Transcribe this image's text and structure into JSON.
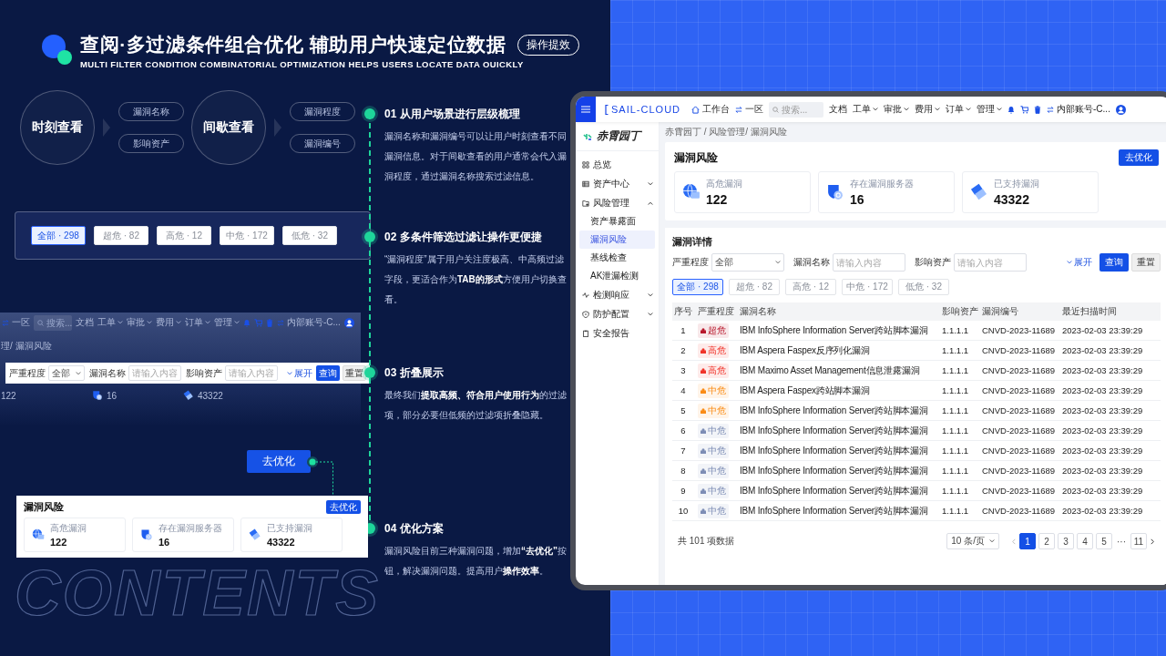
{
  "header": {
    "title": "查阅·多过滤条件组合优化 辅助用户快速定位数据",
    "subtitle": "MULTI FILTER CONDITION COMBINATORIAL OPTIMIZATION HELPS USERS LOCATE DATA OUICKLY",
    "badge": "操作提效"
  },
  "scenarios": [
    {
      "mode": "时刻查看",
      "fields": [
        "漏洞名称",
        "影响资产"
      ]
    },
    {
      "mode": "间歇查看",
      "fields": [
        "漏洞程度",
        "漏洞编号"
      ]
    }
  ],
  "tab_demo": [
    {
      "label": "全部 · 298",
      "selected": true
    },
    {
      "label": "超危 · 82",
      "selected": false
    },
    {
      "label": "高危 · 12",
      "selected": false
    },
    {
      "label": "中危 · 172",
      "selected": false
    },
    {
      "label": "低危 · 32",
      "selected": false
    }
  ],
  "steps": [
    {
      "title": "01 从用户场景进行层级梳理",
      "text": "漏洞名称和漏洞编号可以让用户时刻查看不同漏洞信息。对于间歇查看的用户通常会代入漏洞程度，通过漏洞名称搜索过滤信息。"
    },
    {
      "title": "02 多条件筛选过滤让操作更便捷",
      "text": "“漏洞程度”属于用户关注度极高、中高频过滤字段，更适合作为**TAB的形式**方便用户切换查看。"
    },
    {
      "title": "03 折叠展示",
      "text": "最终我们**提取高频、符合用户使用行为**的过滤项，部分必要但低频的过滤项折叠隐藏。"
    },
    {
      "title": "04 优化方案",
      "text": "漏洞风险目前三种漏洞问题，增加**“去优化”**按钮，解决漏洞问题。提高用户**操作效率**。"
    }
  ],
  "faded_screen": {
    "topbar": {
      "region": "一区",
      "search": {
        "placeholder": "搜索..."
      },
      "menus": [
        {
          "label": "文档",
          "dropdown": false
        },
        {
          "label": "工单",
          "dropdown": true
        },
        {
          "label": "审批",
          "dropdown": true
        },
        {
          "label": "费用",
          "dropdown": true
        },
        {
          "label": "订单",
          "dropdown": true
        },
        {
          "label": "管理",
          "dropdown": true
        }
      ],
      "account": "内部账号-C..."
    },
    "breadcrumb": "理/ 漏洞风险",
    "values": [
      "122",
      "16",
      "43322"
    ]
  },
  "filter_demo": {
    "fields": [
      {
        "label": "严重程度",
        "kind": "select",
        "value": "全部"
      },
      {
        "label": "漏洞名称",
        "kind": "input",
        "placeholder": "请输入内容"
      },
      {
        "label": "影响资产",
        "kind": "input",
        "placeholder": "请输入内容"
      }
    ],
    "expand": "展开",
    "buttons": [
      {
        "label": "查询",
        "kind": "primary"
      },
      {
        "label": "重置",
        "kind": "default"
      }
    ]
  },
  "callout_button": "去优化",
  "risk_demo": {
    "title": "漏洞风险",
    "button": "去优化",
    "stats": [
      {
        "label": "高危漏洞",
        "value": "122"
      },
      {
        "label": "存在漏洞服务器",
        "value": "16"
      },
      {
        "label": "已支持漏洞",
        "value": "43322"
      }
    ]
  },
  "background_word": "CONTENTS",
  "app": {
    "logo": "SAIL-CLOUD",
    "topbar": {
      "workbench": "工作台",
      "region": "一区",
      "search": {
        "placeholder": "搜索..."
      },
      "menus": [
        {
          "label": "文档",
          "dropdown": false
        },
        {
          "label": "工单",
          "dropdown": true
        },
        {
          "label": "审批",
          "dropdown": true
        },
        {
          "label": "费用",
          "dropdown": true
        },
        {
          "label": "订单",
          "dropdown": true
        },
        {
          "label": "管理",
          "dropdown": true
        }
      ],
      "account": "内部账号-C..."
    },
    "sidebar": {
      "brand": "赤霄园丁",
      "items": [
        {
          "label": "总览",
          "kind": "link",
          "selected": false
        },
        {
          "label": "资产中心",
          "kind": "group",
          "expanded": false,
          "selected": false
        },
        {
          "label": "风险管理",
          "kind": "group",
          "expanded": true,
          "selected": false,
          "children": [
            {
              "label": "资产暴露面",
              "selected": false
            },
            {
              "label": "漏洞风险",
              "selected": true
            },
            {
              "label": "基线检查",
              "selected": false
            },
            {
              "label": "AK泄漏检测",
              "selected": false
            }
          ]
        },
        {
          "label": "检测响应",
          "kind": "group",
          "expanded": false,
          "selected": false
        },
        {
          "label": "防护配置",
          "kind": "group",
          "expanded": false,
          "selected": false
        },
        {
          "label": "安全报告",
          "kind": "link",
          "selected": false
        }
      ]
    },
    "breadcrumb": "赤霄园丁 / 风险管理/ 漏洞风险",
    "risk": {
      "title": "漏洞风险",
      "button": "去优化",
      "stats": [
        {
          "label": "高危漏洞",
          "value": "122"
        },
        {
          "label": "存在漏洞服务器",
          "value": "16"
        },
        {
          "label": "已支持漏洞",
          "value": "43322"
        }
      ]
    },
    "detail": {
      "title": "漏洞详情",
      "filters": {
        "fields": [
          {
            "label": "严重程度",
            "kind": "select",
            "value": "全部"
          },
          {
            "label": "漏洞名称",
            "kind": "input",
            "placeholder": "请输入内容"
          },
          {
            "label": "影响资产",
            "kind": "input",
            "placeholder": "请输入内容"
          }
        ],
        "expand": "展开",
        "buttons": [
          {
            "label": "查询",
            "kind": "primary"
          },
          {
            "label": "重置",
            "kind": "default"
          }
        ]
      },
      "tabs": [
        {
          "label": "全部 · 298",
          "selected": true
        },
        {
          "label": "超危 · 82",
          "selected": false
        },
        {
          "label": "高危 · 12",
          "selected": false
        },
        {
          "label": "中危 · 172",
          "selected": false
        },
        {
          "label": "低危 · 32",
          "selected": false
        }
      ],
      "table": {
        "columns": [
          "序号",
          "严重程度",
          "漏洞名称",
          "影响资产",
          "漏洞编号",
          "最近扫描时间"
        ],
        "rows": [
          {
            "no": "1",
            "severity": "超危",
            "color": "#b8182c",
            "name": "IBM InfoSphere Information Server跨站脚本漏洞",
            "asset": "1.1.1.1",
            "id": "CNVD-2023-11689",
            "time": "2023-02-03 23:39:29"
          },
          {
            "no": "2",
            "severity": "高危",
            "color": "#f0342a",
            "name": "IBM Aspera Faspex反序列化漏洞",
            "asset": "1.1.1.1",
            "id": "CNVD-2023-11689",
            "time": "2023-02-03 23:39:29"
          },
          {
            "no": "3",
            "severity": "高危",
            "color": "#f0342a",
            "name": "IBM Maximo Asset Management信息泄露漏洞",
            "asset": "1.1.1.1",
            "id": "CNVD-2023-11689",
            "time": "2023-02-03 23:39:29"
          },
          {
            "no": "4",
            "severity": "中危",
            "color": "#fa8c16",
            "name": "IBM Aspera Faspex跨站脚本漏洞",
            "asset": "1.1.1.1",
            "id": "CNVD-2023-11689",
            "time": "2023-02-03 23:39:29"
          },
          {
            "no": "5",
            "severity": "中危",
            "color": "#fa8c16",
            "name": "IBM InfoSphere Information Server跨站脚本漏洞",
            "asset": "1.1.1.1",
            "id": "CNVD-2023-11689",
            "time": "2023-02-03 23:39:29"
          },
          {
            "no": "6",
            "severity": "中危",
            "color": "#7d8db5",
            "name": "IBM InfoSphere Information Server跨站脚本漏洞",
            "asset": "1.1.1.1",
            "id": "CNVD-2023-11689",
            "time": "2023-02-03 23:39:29"
          },
          {
            "no": "7",
            "severity": "中危",
            "color": "#7d8db5",
            "name": "IBM InfoSphere Information Server跨站脚本漏洞",
            "asset": "1.1.1.1",
            "id": "CNVD-2023-11689",
            "time": "2023-02-03 23:39:29"
          },
          {
            "no": "8",
            "severity": "中危",
            "color": "#7d8db5",
            "name": "IBM InfoSphere Information Server跨站脚本漏洞",
            "asset": "1.1.1.1",
            "id": "CNVD-2023-11689",
            "time": "2023-02-03 23:39:29"
          },
          {
            "no": "9",
            "severity": "中危",
            "color": "#7d8db5",
            "name": "IBM InfoSphere Information Server跨站脚本漏洞",
            "asset": "1.1.1.1",
            "id": "CNVD-2023-11689",
            "time": "2023-02-03 23:39:29"
          },
          {
            "no": "10",
            "severity": "中危",
            "color": "#7d8db5",
            "name": "IBM InfoSphere Information Server跨站脚本漏洞",
            "asset": "1.1.1.1",
            "id": "CNVD-2023-11689",
            "time": "2023-02-03 23:39:29"
          }
        ]
      },
      "total": "共 101 项数据",
      "page_size": "10 条/页",
      "pages": [
        {
          "label": "1",
          "kind": "page",
          "selected": true
        },
        {
          "label": "2",
          "kind": "page",
          "selected": false
        },
        {
          "label": "3",
          "kind": "page",
          "selected": false
        },
        {
          "label": "4",
          "kind": "page",
          "selected": false
        },
        {
          "label": "5",
          "kind": "page",
          "selected": false
        },
        {
          "label": "···",
          "kind": "ellipsis",
          "selected": false
        },
        {
          "label": "11",
          "kind": "page",
          "selected": false
        }
      ]
    }
  }
}
